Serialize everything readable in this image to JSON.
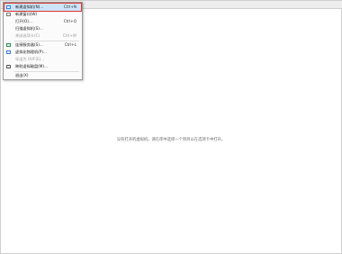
{
  "empty_hint": "没有打开的虚拟机。请在库中选择一个项目以在选项卡中打开。",
  "menu": {
    "items": [
      {
        "label": "新建虚拟机(N)...",
        "shortcut": "Ctrl+N",
        "icon": "new-vm-icon",
        "highlight": true
      },
      {
        "label": "新建窗口(W)",
        "shortcut": "",
        "icon": "new-window-icon"
      },
      {
        "label": "打开(O)...",
        "shortcut": "Ctrl+O",
        "icon": ""
      },
      {
        "label": "扫描虚拟机(S)...",
        "shortcut": "",
        "icon": ""
      },
      {
        "label": "关闭选项卡(C)",
        "shortcut": "Ctrl+W",
        "icon": "",
        "disabled": true
      },
      {
        "label": "连接服务器(S)...",
        "shortcut": "Ctrl+L",
        "icon": "connect-server-icon"
      },
      {
        "label": "虚拟化物理机(P)...",
        "shortcut": "",
        "icon": "virtualize-physical-icon"
      },
      {
        "label": "导出为 OVF(E)...",
        "shortcut": "",
        "icon": "",
        "disabled": true
      },
      {
        "label": "映射虚拟磁盘(M)...",
        "shortcut": "",
        "icon": "map-disk-icon"
      },
      {
        "label": "退出(X)",
        "shortcut": "",
        "icon": ""
      }
    ]
  }
}
